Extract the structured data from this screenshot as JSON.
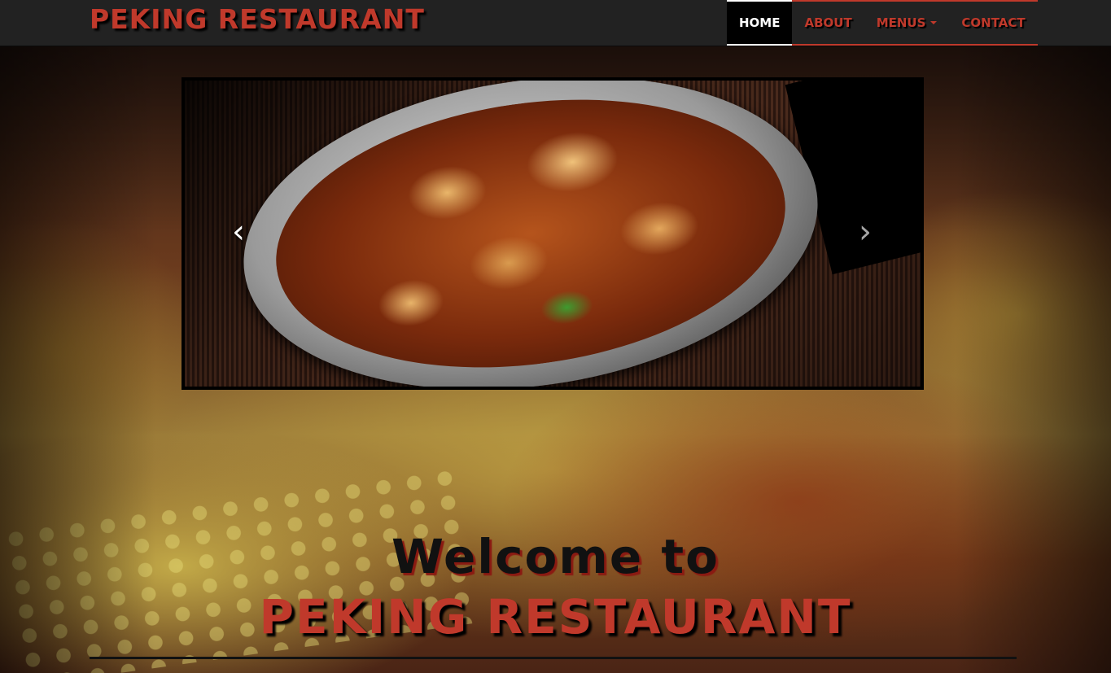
{
  "navbar": {
    "brand": "Peking Restaurant",
    "items": [
      {
        "label": "Home",
        "active": true
      },
      {
        "label": "About",
        "active": false
      },
      {
        "label": "Menus",
        "active": false,
        "dropdown": true
      },
      {
        "label": "Contact",
        "active": false
      }
    ]
  },
  "carousel": {
    "slide_description_icon": "food-photo",
    "prev_glyph": "‹",
    "next_glyph": "›"
  },
  "hero": {
    "welcome": "Welcome to",
    "name": "Peking Restaurant"
  },
  "colors": {
    "accent": "#c0392b",
    "navbar_bg": "#222222",
    "active_bg": "#000000"
  }
}
